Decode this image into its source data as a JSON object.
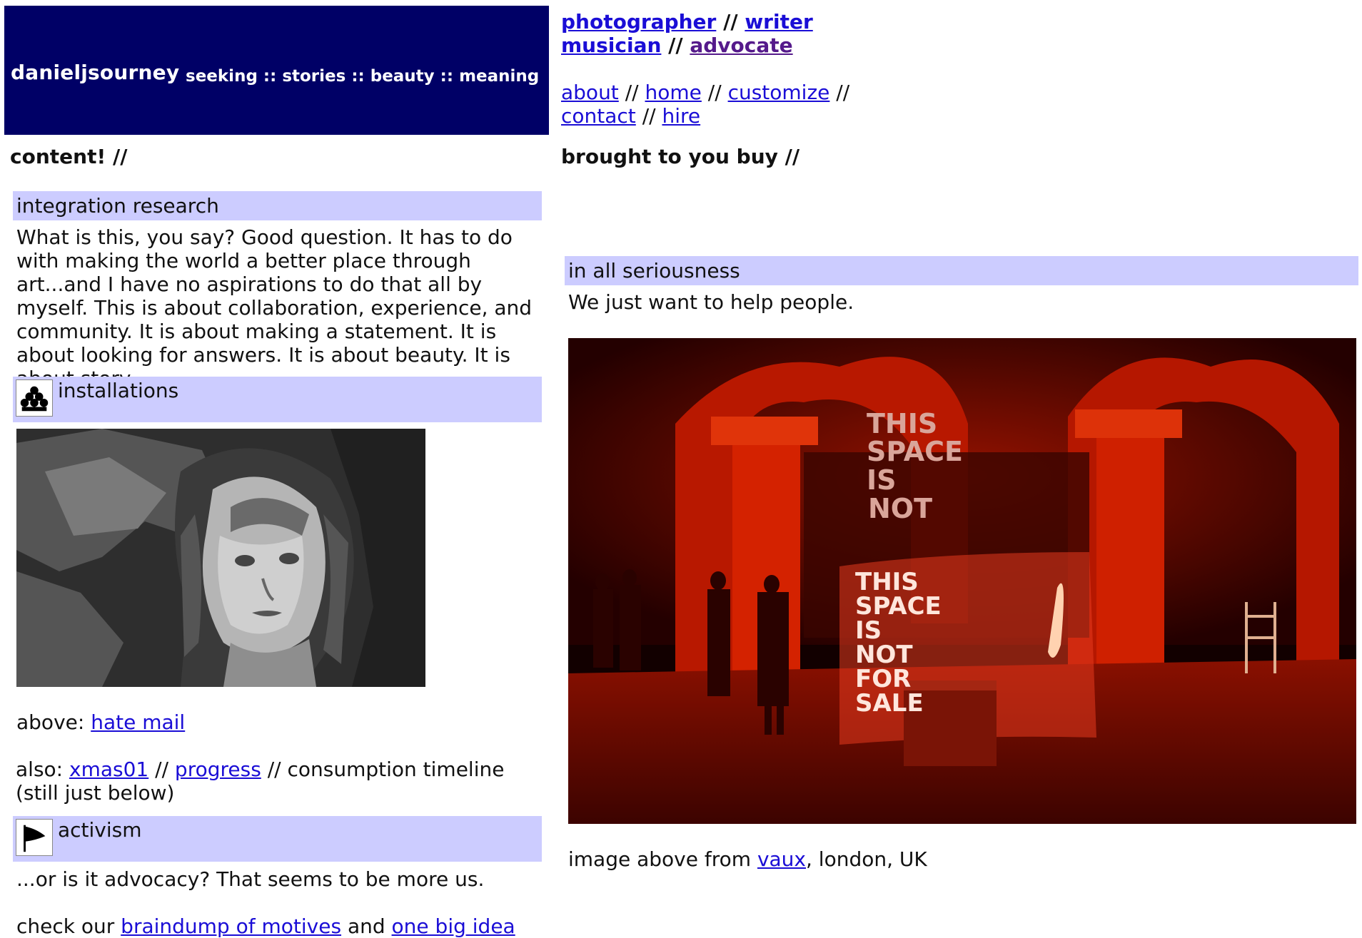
{
  "header": {
    "site_name": "danieljsourney",
    "tagline": "seeking :: stories :: beauty :: meaning"
  },
  "roles": {
    "photographer": "photographer",
    "writer": "writer",
    "musician": "musician",
    "advocate": "advocate",
    "separator": "//"
  },
  "nav": {
    "about": "about",
    "home": "home",
    "customize": "customize",
    "contact": "contact",
    "hire": "hire",
    "separator": "//"
  },
  "left": {
    "title": "content! //",
    "integration": {
      "heading": "integration research",
      "body": "What is this, you say? Good question. It has to do with making the world a better place through art...and I have no aspirations to do that all by myself. This is about collaboration, experience, and community. It is about making a statement. It is about looking for answers. It is about beauty. It is about story."
    },
    "installations": {
      "heading": "installations",
      "icon": "sculpture-icon",
      "image_alt": "posterized portrait of a child looking up",
      "above_label": "above:",
      "above_link": "hate mail",
      "also_label": "also:",
      "also_link1": "xmas01",
      "also_link2": "progress",
      "also_tail": "consumption timeline (still just below)",
      "separator": "//"
    },
    "activism": {
      "heading": "activism",
      "icon": "flag-icon",
      "body": "...or is it advocacy? That seems to be more us.",
      "check_prefix": "check our",
      "check_link1": "braindump of motives",
      "check_and": "and",
      "check_link2": "one big idea"
    }
  },
  "right": {
    "title": "brought to you buy //",
    "seriousness": {
      "heading": "in all seriousness",
      "body": "We just want to help people."
    },
    "photo": {
      "sign_lines": [
        "THIS",
        "SPACE",
        "IS",
        "NOT",
        "FOR",
        "SALE"
      ],
      "caption_prefix": "image above from",
      "caption_link": "vaux",
      "caption_suffix": ", london, UK"
    }
  },
  "colors": {
    "banner": "#000066",
    "section_bar": "#ccccff",
    "link": "#1a0dd6",
    "visited_link": "#551a8b"
  }
}
